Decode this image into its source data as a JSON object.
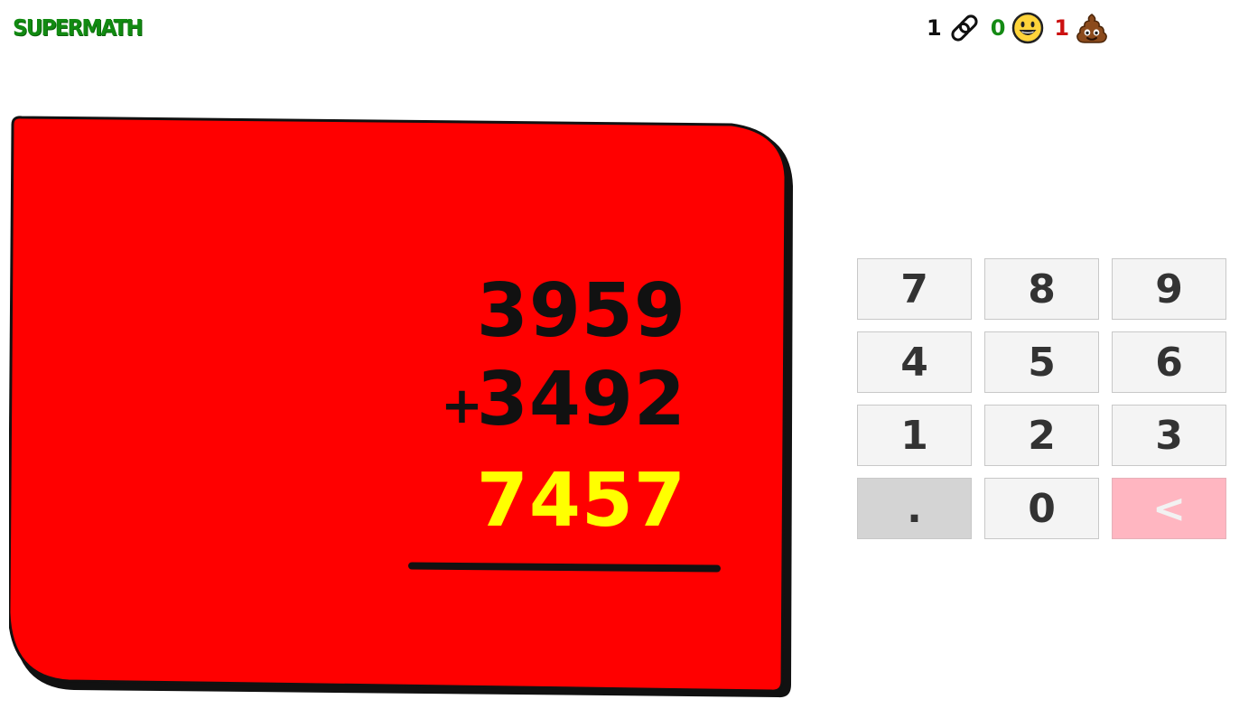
{
  "header": {
    "logo": "SUPERMATH"
  },
  "scores": {
    "streak": "1",
    "correct": "0",
    "wrong": "1",
    "colors": {
      "streak": "#111111",
      "correct": "#148a14",
      "wrong": "#cc1111"
    }
  },
  "problem": {
    "top_operand": "3959",
    "operator": "+",
    "bottom_operand": "3492",
    "answer_input": "7457",
    "card_color": "#ff0000",
    "answer_color": "#ffff00"
  },
  "keypad": {
    "keys": [
      "7",
      "8",
      "9",
      "4",
      "5",
      "6",
      "1",
      "2",
      "3",
      ".",
      "0",
      "<"
    ]
  }
}
